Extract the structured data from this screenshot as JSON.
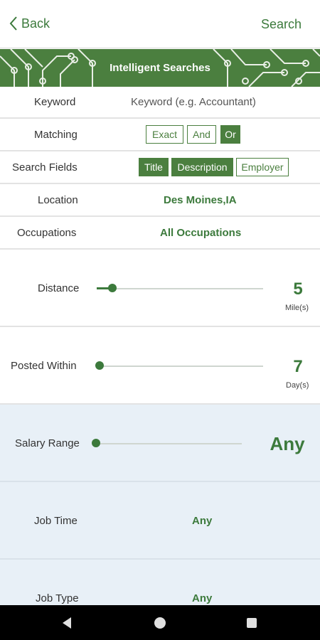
{
  "header": {
    "back_label": "Back",
    "search_label": "Search"
  },
  "banner": {
    "title": "Intelligent Searches"
  },
  "form": {
    "keyword": {
      "label": "Keyword",
      "placeholder": "Keyword (e.g. Accountant)"
    },
    "matching": {
      "label": "Matching",
      "options": [
        "Exact",
        "And",
        "Or"
      ],
      "selected": "Or"
    },
    "search_fields": {
      "label": "Search Fields",
      "options": [
        "Title",
        "Description",
        "Employer"
      ],
      "selected": [
        "Title",
        "Description"
      ]
    },
    "location": {
      "label": "Location",
      "value": "Des Moines,IA"
    },
    "occupations": {
      "label": "Occupations",
      "value": "All Occupations"
    },
    "distance": {
      "label": "Distance",
      "value": "5",
      "unit": "Mile(s)"
    },
    "posted_within": {
      "label": "Posted Within",
      "value": "7",
      "unit": "Day(s)"
    },
    "salary_range": {
      "label": "Salary Range",
      "value": "Any"
    },
    "job_time": {
      "label": "Job Time",
      "value": "Any"
    },
    "job_type": {
      "label": "Job Type",
      "value": "Any"
    }
  },
  "colors": {
    "accent": "#4b7f3f",
    "highlight_row": "#e8f0f7"
  },
  "navbar": {
    "icons": [
      "back-triangle-icon",
      "home-circle-icon",
      "recents-square-icon"
    ]
  }
}
